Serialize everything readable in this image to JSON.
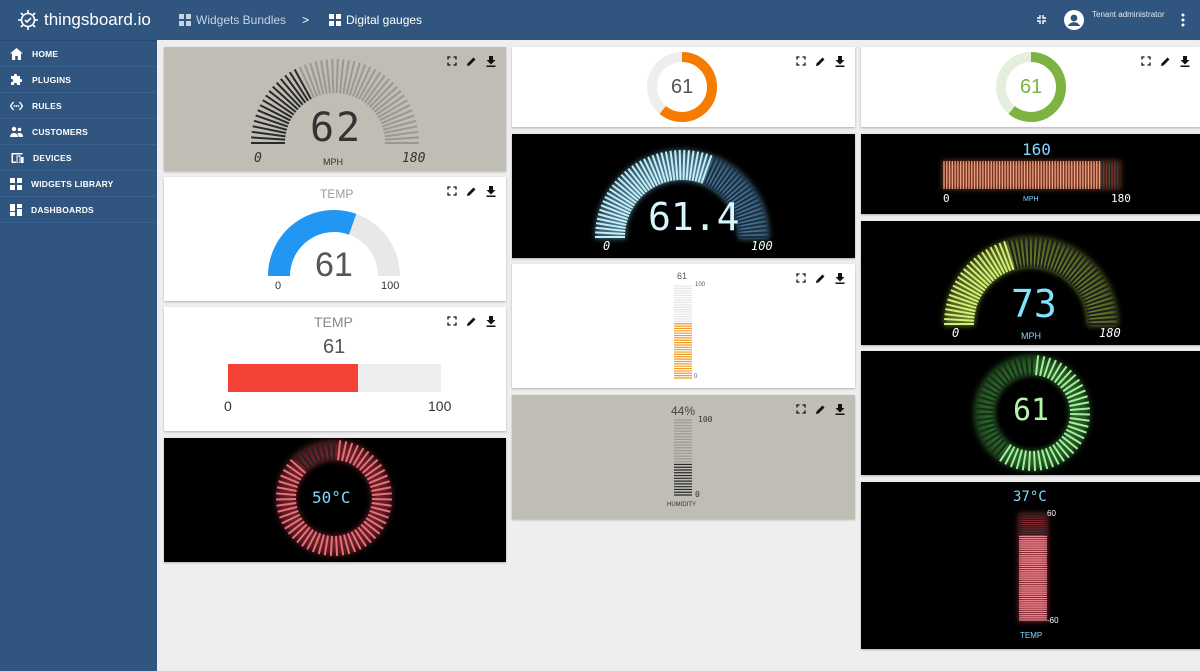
{
  "app": {
    "name": "thingsboard.io"
  },
  "breadcrumb": {
    "parent": "Widgets Bundles",
    "separator": ">",
    "current": "Digital gauges"
  },
  "user": {
    "role": "Tenant administrator"
  },
  "sidebar": {
    "items": [
      {
        "label": "HOME",
        "icon": "home-icon"
      },
      {
        "label": "PLUGINS",
        "icon": "puzzle-icon"
      },
      {
        "label": "RULES",
        "icon": "settings-ethernet-icon"
      },
      {
        "label": "CUSTOMERS",
        "icon": "supervisor-account-icon"
      },
      {
        "label": "DEVICES",
        "icon": "devices-other-icon"
      },
      {
        "label": "WIDGETS LIBRARY",
        "icon": "widgets-icon"
      },
      {
        "label": "DASHBOARDS",
        "icon": "dashboard-icon"
      }
    ]
  },
  "widgets": {
    "speed_lcd": {
      "value": "62",
      "unit": "MPH",
      "min": "0",
      "max": "180",
      "level": 0.344
    },
    "temp_arc": {
      "title": "TEMP",
      "value": "61",
      "min": "0",
      "max": "100",
      "level": 0.61,
      "color": "#2196f3"
    },
    "temp_bar": {
      "title": "TEMP",
      "value": "61",
      "min": "0",
      "max": "100",
      "level": 0.61,
      "color": "#f44336"
    },
    "temp_donut": {
      "value": "50°C",
      "level": 0.88
    },
    "donut_orange": {
      "value": "61",
      "level": 0.61,
      "color": "#f57c00"
    },
    "arc_neon_blue": {
      "value": "61.4",
      "min": "0",
      "max": "100",
      "level": 0.614
    },
    "vbar_orange": {
      "value": "61",
      "max": "100",
      "min": "0",
      "level": 0.61,
      "color": "#f29a27"
    },
    "humidity": {
      "value": "44%",
      "max": "100",
      "min": "0",
      "label": "HUMIDITY",
      "level": 0.44
    },
    "donut_green": {
      "value": "61",
      "level": 0.61,
      "color": "#7cb342"
    },
    "hbar_mph": {
      "value": "160",
      "unit": "MPH",
      "min": "0",
      "max": "180",
      "level": 0.889
    },
    "arc_neon_yellow": {
      "value": "73",
      "unit": "MPH",
      "min": "0",
      "max": "180",
      "level": 0.405
    },
    "donut_neon_green": {
      "value": "61",
      "level": 0.61
    },
    "vbar_temp": {
      "value": "37°C",
      "max": "60",
      "min": "-60",
      "label": "TEMP",
      "level": 0.808
    }
  }
}
